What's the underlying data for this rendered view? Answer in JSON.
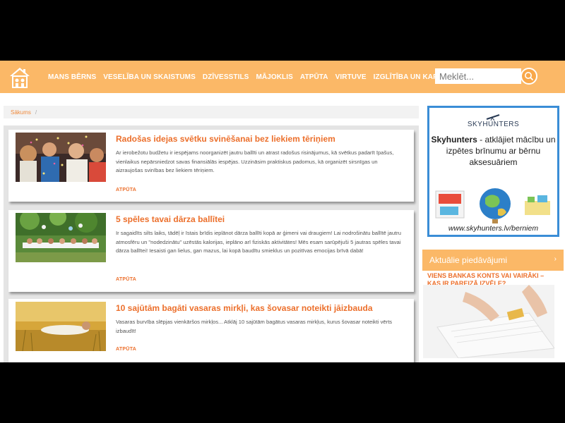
{
  "header": {
    "nav": [
      "MANS BĒRNS",
      "VESELĪBA UN SKAISTUMS",
      "DZĪVESSTILS",
      "MĀJOKLIS",
      "ATPŪTA",
      "VIRTUVE",
      "IZGLĪTĪBA UN KARJERA"
    ],
    "search_placeholder": "Meklēt...",
    "accent": "#fbb867"
  },
  "breadcrumb": {
    "home": "Sākums",
    "separator": "/"
  },
  "articles": [
    {
      "title": "Radošas idejas svētku svinēšanai bez liekiem tēriņiem",
      "excerpt": "Ar ierobežotu budžetu ir iespējams noorganizēt jautru ballīti un atrast radošus risinājumus, kā svētkus padarīt īpašus, vienlaikus nepārsniedzot savas finansiālās iespējas. Uzzināsim praktiskus padomus, kā organizēt sirsnīgas un aizraujošas svinības bez liekiem tēriņiem.",
      "category": "ATPŪTA"
    },
    {
      "title": "5 spēles tavai dārza ballītei",
      "excerpt": "Ir sagaidīts silts laiks, tādēļ ir īstais brīdis ieplānot dārza ballīti kopā ar ģimeni vai draugiem! Lai nodrošinātu ballītē jautru atmosfēru un \"nodedzinātu\" uzēstās kalorijas, ieplāno arī fiziskās aktivitātes! Mēs esam sarūpējuši 5 jautras spēles tavai dārza ballītei! Iesaisti gan lielus, gan mazus, lai kopā baudītu smieklus un pozitīvas emocijas brīvā dabā!",
      "category": "ATPŪTA"
    },
    {
      "title": "10 sajūtām bagāti vasaras mirkļi, kas šovasar noteikti jāizbauda",
      "excerpt": "Vasaras burvība slēpjas vienkāršos mirkļos... Atklāj 10 sajūtām bagātus vasaras mirkļus, kurus šovasar noteikti vērts izbaudīt!",
      "category": "ATPŪTA"
    }
  ],
  "sidebar": {
    "ad": {
      "logo": "SKYHUNTERS",
      "brand": "Skyhunters",
      "text": " - atklājiet mācību un izpētes brīnumu ar bērnu aksesuāriem",
      "url": "www.skyhunters.lv/berniem"
    },
    "offers_heading": "Aktuālie piedāvājumi",
    "offer_title": "VIENS BANKAS KONTS VAI VAIRĀKI – KAS IR PAREIZĀ IZVĒLE?"
  }
}
